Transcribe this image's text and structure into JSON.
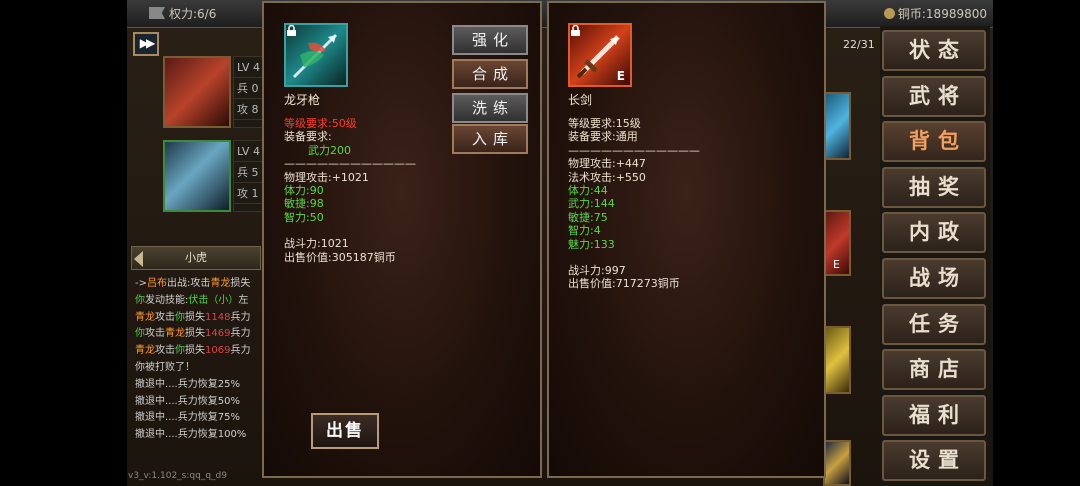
{
  "topbar": {
    "power_label": "权力:6/6",
    "coins_label": "铜币:18989800"
  },
  "bag": {
    "count": "22/31"
  },
  "heroes": [
    {
      "lv": "LV 4",
      "bing": "兵 0",
      "gong": "攻 8"
    },
    {
      "lv": "LV 4",
      "bing": "兵 5",
      "gong": "攻 1"
    }
  ],
  "log": {
    "title": "小虎",
    "lines": [
      [
        {
          "t": "->",
          "c": ""
        },
        {
          "t": "吕布",
          "c": "orange"
        },
        {
          "t": "出战:攻击",
          "c": ""
        },
        {
          "t": "青龙",
          "c": "orange"
        },
        {
          "t": "损失",
          "c": ""
        }
      ],
      [
        {
          "t": "你",
          "c": "green"
        },
        {
          "t": "发动技能:",
          "c": ""
        },
        {
          "t": "伏击（小）",
          "c": "green"
        },
        {
          "t": "左",
          "c": ""
        }
      ],
      [
        {
          "t": "青龙",
          "c": "orange"
        },
        {
          "t": "攻击",
          "c": ""
        },
        {
          "t": "你",
          "c": "green"
        },
        {
          "t": "损失",
          "c": ""
        },
        {
          "t": "1148",
          "c": "red"
        },
        {
          "t": "兵力",
          "c": ""
        }
      ],
      [
        {
          "t": "你",
          "c": "green"
        },
        {
          "t": "攻击",
          "c": ""
        },
        {
          "t": "青龙",
          "c": "orange"
        },
        {
          "t": "损失",
          "c": ""
        },
        {
          "t": "1469",
          "c": "red"
        },
        {
          "t": "兵力",
          "c": ""
        }
      ],
      [
        {
          "t": "青龙",
          "c": "orange"
        },
        {
          "t": "攻击",
          "c": ""
        },
        {
          "t": "你",
          "c": "green"
        },
        {
          "t": "损失",
          "c": ""
        },
        {
          "t": "1069",
          "c": "red"
        },
        {
          "t": "兵力",
          "c": ""
        }
      ],
      [
        {
          "t": "你被打败了！",
          "c": ""
        }
      ],
      [
        {
          "t": "撤退中....兵力恢复25%",
          "c": ""
        }
      ],
      [
        {
          "t": "撤退中....兵力恢复50%",
          "c": ""
        }
      ],
      [
        {
          "t": "撤退中....兵力恢复75%",
          "c": ""
        }
      ],
      [
        {
          "t": "撤退中....兵力恢复100%",
          "c": ""
        }
      ]
    ]
  },
  "version": "v3_v:1.102_s:qq_q_d9",
  "menu": {
    "items": [
      "状态",
      "武将",
      "背包",
      "抽奖",
      "内政",
      "战场",
      "任务",
      "商店",
      "福利",
      "设置"
    ],
    "active_index": 2
  },
  "left_item": {
    "name": "龙牙枪",
    "level_req": "等级要求:50级",
    "equip_req": "装备要求:",
    "equip_req_value": "武力200",
    "separator": "————————————",
    "phys_attack": "物理攻击:+1021",
    "stats": [
      "体力:90",
      "敏捷:98",
      "智力:50"
    ],
    "combat": "战斗力:1021",
    "sell_price": "出售价值:305187铜币",
    "actions": [
      "强化",
      "合成",
      "洗练",
      "入库"
    ],
    "sell_label": "出售"
  },
  "right_item": {
    "name": "长剑",
    "badge": "E",
    "level_req": "等级要求:15级",
    "equip_req": "装备要求:通用",
    "separator": "————————————",
    "phys_attack": "物理攻击:+447",
    "magic_attack": "法术攻击:+550",
    "stats": [
      "体力:44",
      "武力:144",
      "敏捷:75",
      "智力:4",
      "魅力:133"
    ],
    "combat": "战斗力:997",
    "sell_price": "出售价值:717273铜币"
  },
  "colors": {
    "required_red": "#ff3b2f",
    "stat_green": "#5ad64e",
    "panel_border": "#7d6a4e",
    "menu_active": "#f0a060"
  }
}
